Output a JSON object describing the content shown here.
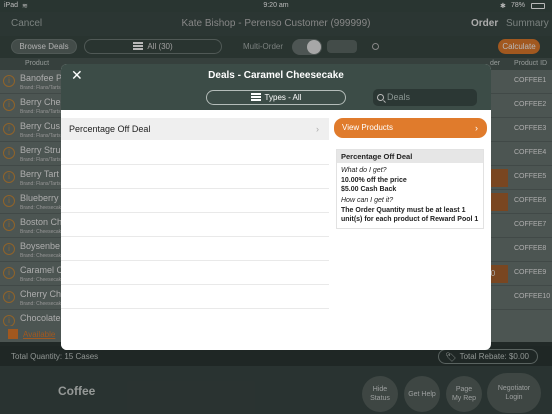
{
  "status_bar": {
    "device": "iPad",
    "time": "9:20 am",
    "battery": "78%"
  },
  "header": {
    "cancel_label": "Cancel",
    "title": "Kate Bishop - Perenso Customer (999999)",
    "order_tab": "Order",
    "summary_tab": "Summary"
  },
  "toolbar": {
    "browse_deals_label": "Browse Deals",
    "all_label": "All (30)",
    "multi_order_label": "Multi-Order",
    "calculate_label": "Calculate"
  },
  "columns": {
    "product": "Product",
    "order": "der",
    "product_id": "Product ID"
  },
  "rows": [
    {
      "name": "Banofee P",
      "brand": "Brand: Flans/Tarts",
      "product_id": "COFFEE1",
      "qty": ""
    },
    {
      "name": "Berry Che",
      "brand": "Brand: Flans/Tarts",
      "product_id": "COFFEE2",
      "qty": ""
    },
    {
      "name": "Berry Cus",
      "brand": "Brand: Flans/Tarts",
      "product_id": "COFFEE3",
      "qty": ""
    },
    {
      "name": "Berry Stru",
      "brand": "Brand: Flans/Tarts",
      "product_id": "COFFEE4",
      "qty": ""
    },
    {
      "name": "Berry Tart",
      "brand": "Brand: Flans/Tarts",
      "product_id": "COFFEE5",
      "qty": ""
    },
    {
      "name": "Blueberry",
      "brand": "Brand: Cheesecake",
      "product_id": "COFFEE6",
      "qty": ""
    },
    {
      "name": "Boston Ch",
      "brand": "Brand: Cheesecake",
      "product_id": "COFFEE7",
      "qty": ""
    },
    {
      "name": "Boysenbe",
      "brand": "Brand: Cheesecake",
      "product_id": "COFFEE8",
      "qty": ""
    },
    {
      "name": "Caramel C",
      "brand": "Brand: Cheesecake",
      "product_id": "COFFEE9",
      "qty": "0"
    },
    {
      "name": "Cherry Ch",
      "brand": "Brand: Cheesecake",
      "product_id": "COFFEE10",
      "qty": ""
    },
    {
      "name": "Chocolate",
      "brand": "",
      "product_id": "",
      "qty": ""
    }
  ],
  "available_label": "Available",
  "totals": {
    "quantity": "Total Quantity: 15 Cases",
    "rebate": "Total Rebate: $0.00"
  },
  "footer": {
    "category": "Coffee",
    "hide_status": "Hide\nStatus",
    "get_help": "Get Help",
    "page_my_rep": "Page\nMy Rep",
    "negotiator_login": "Negotiator\nLogin"
  },
  "modal": {
    "title": "Deals - Caramel Cheesecake",
    "types_label": "Types - All",
    "search_placeholder": "Deals",
    "deal_item": "Percentage Off Deal",
    "view_products_label": "View Products",
    "detail": {
      "title": "Percentage Off Deal",
      "q1": "What do I get?",
      "a1_line1": "10.00% off the price",
      "a1_line2": "$5.00 Cash Back",
      "q2": "How can I get it?",
      "a2_line1": "The Order Quantity must be at least 1",
      "a2_line2": "unit(s) for each product of Reward Pool 1"
    }
  },
  "colors": {
    "accent": "#e07b2c",
    "header_bg": "#3c4c47"
  }
}
